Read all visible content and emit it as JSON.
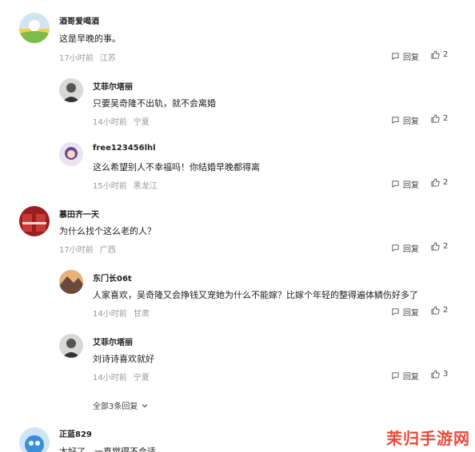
{
  "comments": [
    {
      "user": "酒哥爱喝酒",
      "text": "这是早晚的事。",
      "time": "17小时前",
      "location": "江苏",
      "reply_label": "回复",
      "likes": "2"
    },
    {
      "user": "艾菲尔塔丽",
      "text": "只要吴奇隆不出轨，就不会离婚",
      "time": "14小时前",
      "location": "宁夏",
      "reply_label": "回复",
      "likes": "2"
    },
    {
      "user": "free123456lhl",
      "text": "这么希望别人不幸福吗！你结婚早晚都得离",
      "time": "15小时前",
      "location": "黑龙江",
      "reply_label": "回复",
      "likes": "2"
    },
    {
      "user": "慕田齐一天",
      "text": "为什么找个这么老的人？",
      "time": "17小时前",
      "location": "广西",
      "reply_label": "回复",
      "likes": "2"
    },
    {
      "user": "东门长06t",
      "text": "人家喜欢，吴奇隆又会挣钱又宠她为什么不能嫁？比嫁个年轻的整得遍体鳞伤好多了",
      "time": "14小时前",
      "location": "甘肃",
      "reply_label": "回复",
      "likes": "2"
    },
    {
      "user": "艾菲尔塔丽",
      "text": "刘诗诗喜欢就好",
      "time": "14小时前",
      "location": "宁夏",
      "reply_label": "回复",
      "likes": "3"
    },
    {
      "user": "正蓝829",
      "text": "太好了，一直觉得不合适"
    }
  ],
  "more_replies": "全部3条回复",
  "watermark": "茉归手游网",
  "icons": {
    "reply": "comment-bubble-icon",
    "like": "thumbs-up-icon",
    "expand": "chevron-down-icon"
  }
}
